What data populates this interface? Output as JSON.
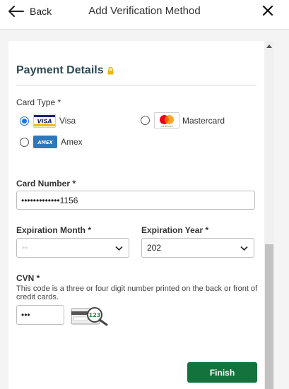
{
  "header": {
    "back_label": "Back",
    "title": "Add Verification Method"
  },
  "payment": {
    "section_title": "Payment Details",
    "card_type": {
      "label": "Card Type *",
      "options": [
        {
          "label": "Visa",
          "selected": true,
          "logo_text": "VISA"
        },
        {
          "label": "Mastercard",
          "selected": false,
          "logo_text": "mastercard"
        },
        {
          "label": "Amex",
          "selected": false,
          "logo_text": "AMEX"
        }
      ]
    },
    "card_number": {
      "label": "Card Number *",
      "value": "•••••••••••••1156"
    },
    "expiration_month": {
      "label": "Expiration Month *",
      "value": "••"
    },
    "expiration_year": {
      "label": "Expiration Year *",
      "value": "202"
    },
    "cvn": {
      "label": "CVN *",
      "help": "This code is a three or four digit number printed on the back or front of credit cards.",
      "value": "•••",
      "hint_digits": "123"
    },
    "finish_label": "Finish"
  },
  "colors": {
    "accent_button": "#14733d",
    "radio_selected": "#1a73e8",
    "heading": "#2f4a52",
    "lock": "#f0b400"
  }
}
